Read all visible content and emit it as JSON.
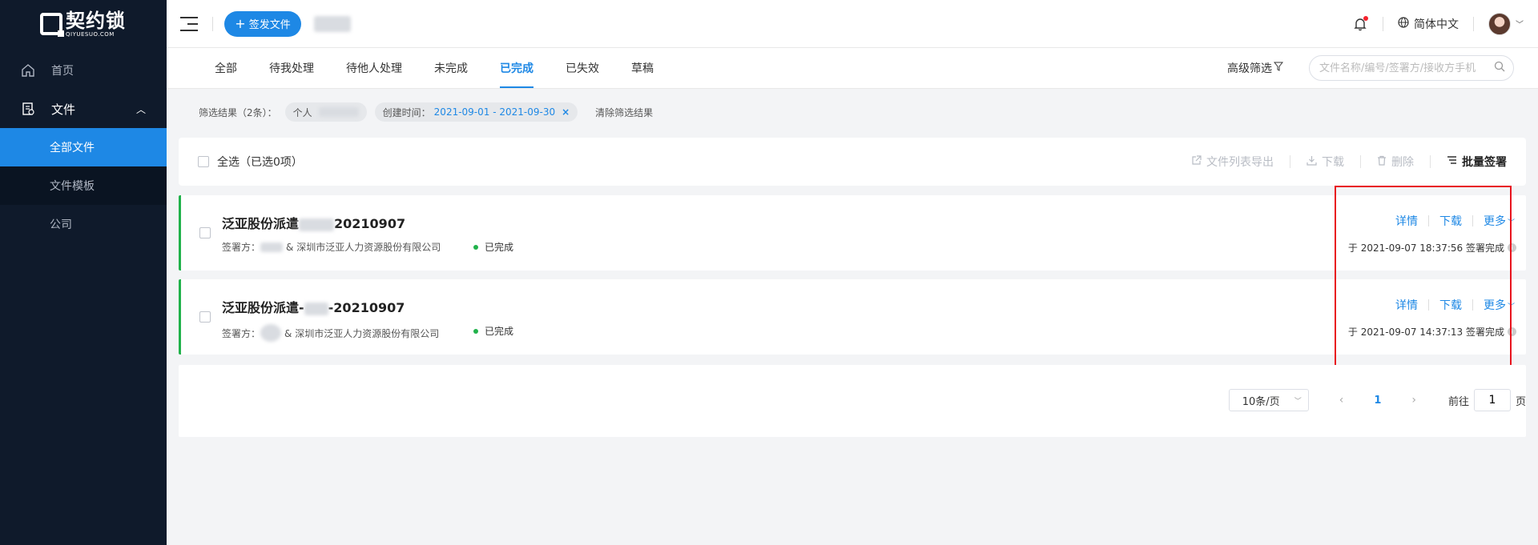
{
  "brand": {
    "name": "契约锁",
    "sub": "QIYUESUO.COM"
  },
  "sidebar": {
    "items": [
      {
        "label": "首页",
        "icon": "home-icon"
      },
      {
        "label": "文件",
        "icon": "document-icon",
        "expanded": true
      }
    ],
    "subitems": [
      {
        "label": "全部文件",
        "active": true
      },
      {
        "label": "文件模板"
      },
      {
        "label": "公司"
      }
    ]
  },
  "header": {
    "new_button": "签发文件",
    "language": "简体中文"
  },
  "tabs": [
    {
      "label": "全部"
    },
    {
      "label": "待我处理"
    },
    {
      "label": "待他人处理"
    },
    {
      "label": "未完成"
    },
    {
      "label": "已完成",
      "active": true
    },
    {
      "label": "已失效"
    },
    {
      "label": "草稿"
    }
  ],
  "advanced_filter": "高级筛选",
  "search": {
    "placeholder": "文件名称/编号/签署方/接收方手机",
    "value": ""
  },
  "filters": {
    "result_label": "筛选结果（2条）：",
    "person_chip": "个人",
    "date_chip_label": "创建时间：",
    "date_chip_value": "2021-09-01 - 2021-09-30",
    "clear_label": "清除筛选结果"
  },
  "toolbar": {
    "select_all": "全选（已选0项）",
    "export": "文件列表导出",
    "download": "下载",
    "delete": "删除",
    "batch_sign": "批量签署"
  },
  "documents": [
    {
      "title_prefix": "泛亚股份派遣",
      "title_suffix": "20210907",
      "signers_label": "签署方：",
      "signers_company": "& 深圳市泛亚人力资源股份有限公司",
      "status": "已完成",
      "actions": {
        "detail": "详情",
        "download": "下载",
        "more": "更多"
      },
      "time": "于 2021-09-07 18:37:56 签署完成"
    },
    {
      "title_prefix": "泛亚股份派遣-",
      "title_suffix": "-20210907",
      "signers_label": "签署方：",
      "signers_company": "& 深圳市泛亚人力资源股份有限公司",
      "status": "已完成",
      "actions": {
        "detail": "详情",
        "download": "下载",
        "more": "更多"
      },
      "time": "于 2021-09-07 14:37:13 签署完成"
    }
  ],
  "pagination": {
    "page_size": "10条/页",
    "current_page": "1",
    "goto_label": "前往",
    "goto_value": "1",
    "page_unit": "页"
  },
  "colors": {
    "accent": "#1e88e5",
    "sidebar_bg": "#0f1a2b",
    "success": "#21b24b",
    "highlight_box": "#e8141e"
  }
}
